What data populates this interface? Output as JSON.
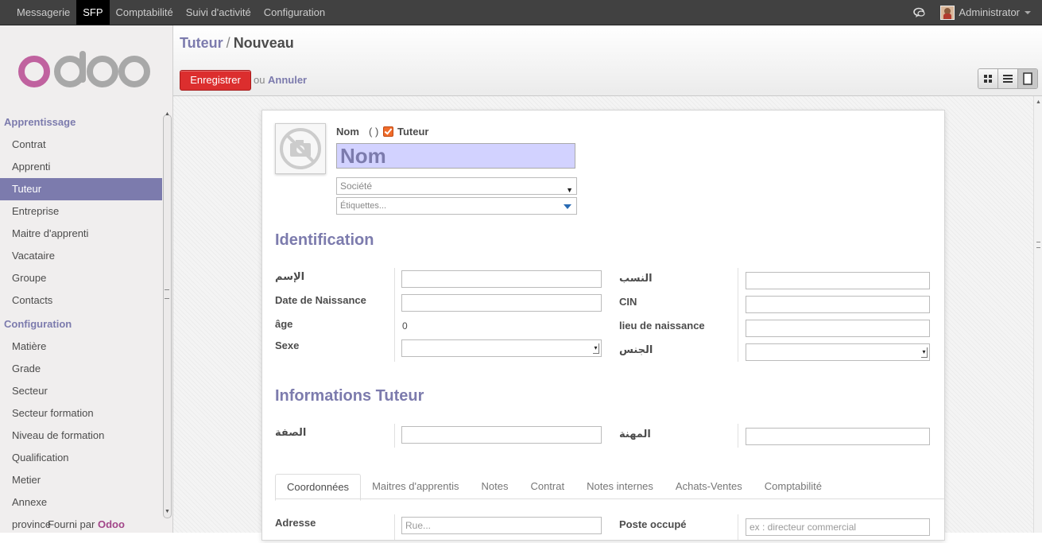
{
  "topnav": {
    "items": [
      "Messagerie",
      "SFP",
      "Comptabilité",
      "Suivi d'activité",
      "Configuration"
    ],
    "active_index": 1,
    "user": "Administrator"
  },
  "logo_text": "odoo",
  "sidebar": {
    "sections": [
      {
        "title": "Apprentissage",
        "items": [
          "Contrat",
          "Apprenti",
          "Tuteur",
          "Entreprise",
          "Maitre d'apprenti",
          "Vacataire",
          "Groupe",
          "Contacts"
        ]
      },
      {
        "title": "Configuration",
        "items": [
          "Matière",
          "Grade",
          "Secteur",
          "Secteur formation",
          "Niveau de formation",
          "Qualification",
          "Metier",
          "Annexe",
          "province"
        ]
      }
    ],
    "active_item": "Tuteur",
    "powered_prefix": "Fourni par",
    "powered_brand": "Odoo"
  },
  "header": {
    "breadcrumb_parent": "Tuteur",
    "breadcrumb_sep": "/",
    "breadcrumb_current": "Nouveau",
    "save_label": "Enregistrer",
    "or_label": "ou",
    "cancel_label": "Annuler"
  },
  "form": {
    "name_label": "Nom",
    "name_paren": "( )",
    "tutor_checkbox_label": "Tuteur",
    "tutor_checked": true,
    "name_placeholder": "Nom",
    "company_placeholder": "Société",
    "tags_placeholder": "Étiquettes...",
    "identification": {
      "title": "Identification",
      "left": [
        {
          "label": "الإسم",
          "value": ""
        },
        {
          "label": "Date de Naissance",
          "value": ""
        },
        {
          "label": "âge",
          "value": "0"
        },
        {
          "label": "Sexe",
          "value": ""
        }
      ],
      "right": [
        {
          "label": "النسب",
          "value": ""
        },
        {
          "label": "CIN",
          "value": ""
        },
        {
          "label": "lieu de naissance",
          "value": ""
        },
        {
          "label": "الجنس",
          "value": ""
        }
      ]
    },
    "tutor_info": {
      "title": "Informations Tuteur",
      "left_label": "الصفة",
      "right_label": "المهنة"
    },
    "tabs": [
      "Coordonnées",
      "Maitres d'apprentis",
      "Notes",
      "Contrat",
      "Notes internes",
      "Achats-Ventes",
      "Comptabilité"
    ],
    "active_tab": "Coordonnées",
    "address_label": "Adresse",
    "street_placeholder": "Rue...",
    "position_label": "Poste occupé",
    "position_placeholder": "ex : directeur commercial"
  },
  "colors": {
    "accent": "#7c7bad",
    "save": "#dc2e2e",
    "topbar": "#414141",
    "brand": "#a24689"
  }
}
